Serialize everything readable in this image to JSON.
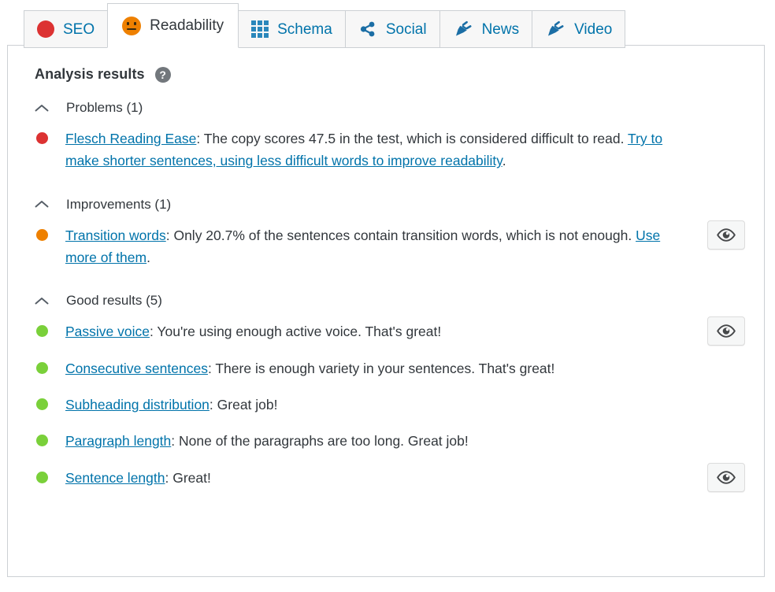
{
  "tabs": [
    {
      "label": "SEO",
      "icon": "seo-bullet-icon",
      "active": false
    },
    {
      "label": "Readability",
      "icon": "neutral-face-icon",
      "active": true
    },
    {
      "label": "Schema",
      "icon": "grid-icon",
      "active": false
    },
    {
      "label": "Social",
      "icon": "share-icon",
      "active": false
    },
    {
      "label": "News",
      "icon": "plug-icon",
      "active": false
    },
    {
      "label": "Video",
      "icon": "plug-icon",
      "active": false
    }
  ],
  "panel": {
    "title": "Analysis results",
    "help_icon_glyph": "?"
  },
  "groups": [
    {
      "name": "problems",
      "title": "Problems (1)",
      "collapse_icon": "chevron-up-icon",
      "results": [
        {
          "bullet": "red",
          "link_text": "Flesch Reading Ease",
          "body_before": ": The copy scores 47.5 in the test, which is considered difficult to read. ",
          "link2_text": "Try to make shorter sentences, using less difficult words to improve readability",
          "body_after": ".",
          "has_eye_button": false
        }
      ]
    },
    {
      "name": "improvements",
      "title": "Improvements (1)",
      "collapse_icon": "chevron-up-icon",
      "results": [
        {
          "bullet": "orange",
          "link_text": "Transition words",
          "body_before": ": Only 20.7% of the sentences contain transition words, which is not enough. ",
          "link2_text": "Use more of them",
          "body_after": ".",
          "has_eye_button": true
        }
      ]
    },
    {
      "name": "good-results",
      "title": "Good results (5)",
      "collapse_icon": "chevron-up-icon",
      "results": [
        {
          "bullet": "green",
          "link_text": "Passive voice",
          "body_before": ": You're using enough active voice. That's great!",
          "link2_text": "",
          "body_after": "",
          "has_eye_button": true
        },
        {
          "bullet": "green",
          "link_text": "Consecutive sentences",
          "body_before": ": There is enough variety in your sentences. That's great!",
          "link2_text": "",
          "body_after": "",
          "has_eye_button": false
        },
        {
          "bullet": "green",
          "link_text": "Subheading distribution",
          "body_before": ": Great job!",
          "link2_text": "",
          "body_after": "",
          "has_eye_button": false
        },
        {
          "bullet": "green",
          "link_text": "Paragraph length",
          "body_before": ": None of the paragraphs are too long. Great job!",
          "link2_text": "",
          "body_after": "",
          "has_eye_button": false
        },
        {
          "bullet": "green",
          "link_text": "Sentence length",
          "body_before": ": Great!",
          "link2_text": "",
          "body_after": "",
          "has_eye_button": true
        }
      ]
    }
  ],
  "colors": {
    "bad": "#dc3232",
    "ok": "#ee8000",
    "good": "#7ad03a",
    "link": "#0073aa",
    "text": "#32373c",
    "border": "#ccd0d4"
  }
}
